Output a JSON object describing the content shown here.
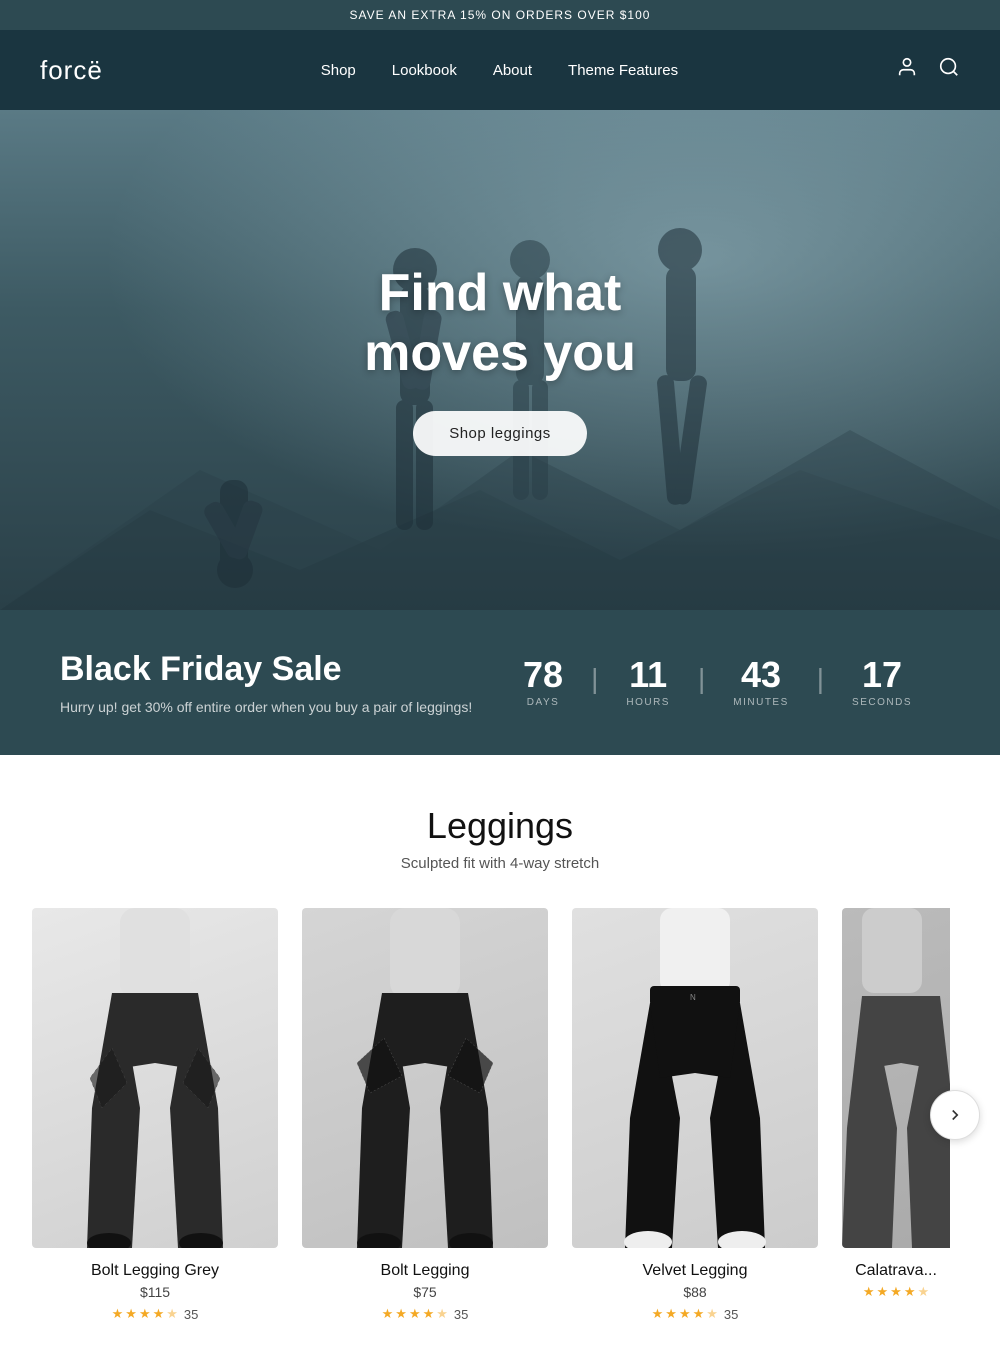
{
  "announcement": {
    "text": "SAVE AN EXTRA 15% ON ORDERS OVER $100"
  },
  "header": {
    "logo": "forcë",
    "nav": [
      {
        "label": "Shop",
        "href": "#"
      },
      {
        "label": "Lookbook",
        "href": "#"
      },
      {
        "label": "About",
        "href": "#"
      },
      {
        "label": "Theme Features",
        "href": "#"
      }
    ]
  },
  "hero": {
    "title_line1": "Find what",
    "title_line2": "moves you",
    "cta_label": "Shop leggings"
  },
  "countdown": {
    "heading": "Black Friday Sale",
    "subtext": "Hurry up! get 30% off entire order when you buy a pair of leggings!",
    "timer": [
      {
        "value": "78",
        "label": "DAYS"
      },
      {
        "value": "11",
        "label": "HOURS"
      },
      {
        "value": "43",
        "label": "MINUTES"
      },
      {
        "value": "17",
        "label": "SECONDS"
      }
    ]
  },
  "products": {
    "section_title": "Leggings",
    "section_subtitle": "Sculpted fit with 4-way stretch",
    "items": [
      {
        "name": "Bolt Legging Grey",
        "price": "$115",
        "rating": 4.5,
        "reviews": 35,
        "style": "grey"
      },
      {
        "name": "Bolt Legging",
        "price": "$75",
        "rating": 4.5,
        "reviews": 35,
        "style": "dark"
      },
      {
        "name": "Velvet Legging",
        "price": "$88",
        "rating": 4.5,
        "reviews": 35,
        "style": "black"
      },
      {
        "name": "Calatrava",
        "price": "",
        "rating": 4.5,
        "reviews": 0,
        "style": "partial"
      }
    ]
  }
}
